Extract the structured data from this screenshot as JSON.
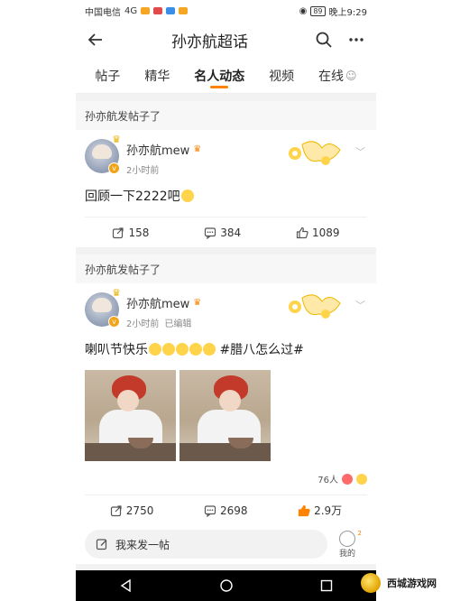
{
  "status_bar": {
    "carrier": "中国电信",
    "signal": "4G",
    "battery": "89",
    "time": "晚上9:29"
  },
  "header": {
    "title": "孙亦航超话",
    "back_icon": "arrow-left-icon",
    "search_icon": "search-icon",
    "more_icon": "more-dots-icon"
  },
  "tabs": [
    {
      "label": "帖子"
    },
    {
      "label": "精华"
    },
    {
      "label": "名人动态",
      "active": true
    },
    {
      "label": "视频"
    },
    {
      "label": "在线"
    }
  ],
  "posts": [
    {
      "section_title": "孙亦航发帖子了",
      "author": "孙亦航mew",
      "time": "2小时前",
      "edited": "",
      "text": "回顾一下2222吧",
      "reposts": "158",
      "comments": "384",
      "likes": "1089"
    },
    {
      "section_title": "孙亦航发帖子了",
      "author": "孙亦航mew",
      "time": "2小时前",
      "edited": "已编辑",
      "text": "喇叭节快乐",
      "text_tag": "#腊八怎么过#",
      "likes_summary": "76人",
      "reposts": "2750",
      "comments": "2698",
      "likes": "2.9万"
    }
  ],
  "compose": {
    "placeholder": "我来发一帖",
    "mine_label": "我的",
    "mine_count": "2"
  },
  "watermark": {
    "text": "西城游戏网"
  },
  "colors": {
    "accent": "#ff8200",
    "background": "#f2f2f2"
  }
}
